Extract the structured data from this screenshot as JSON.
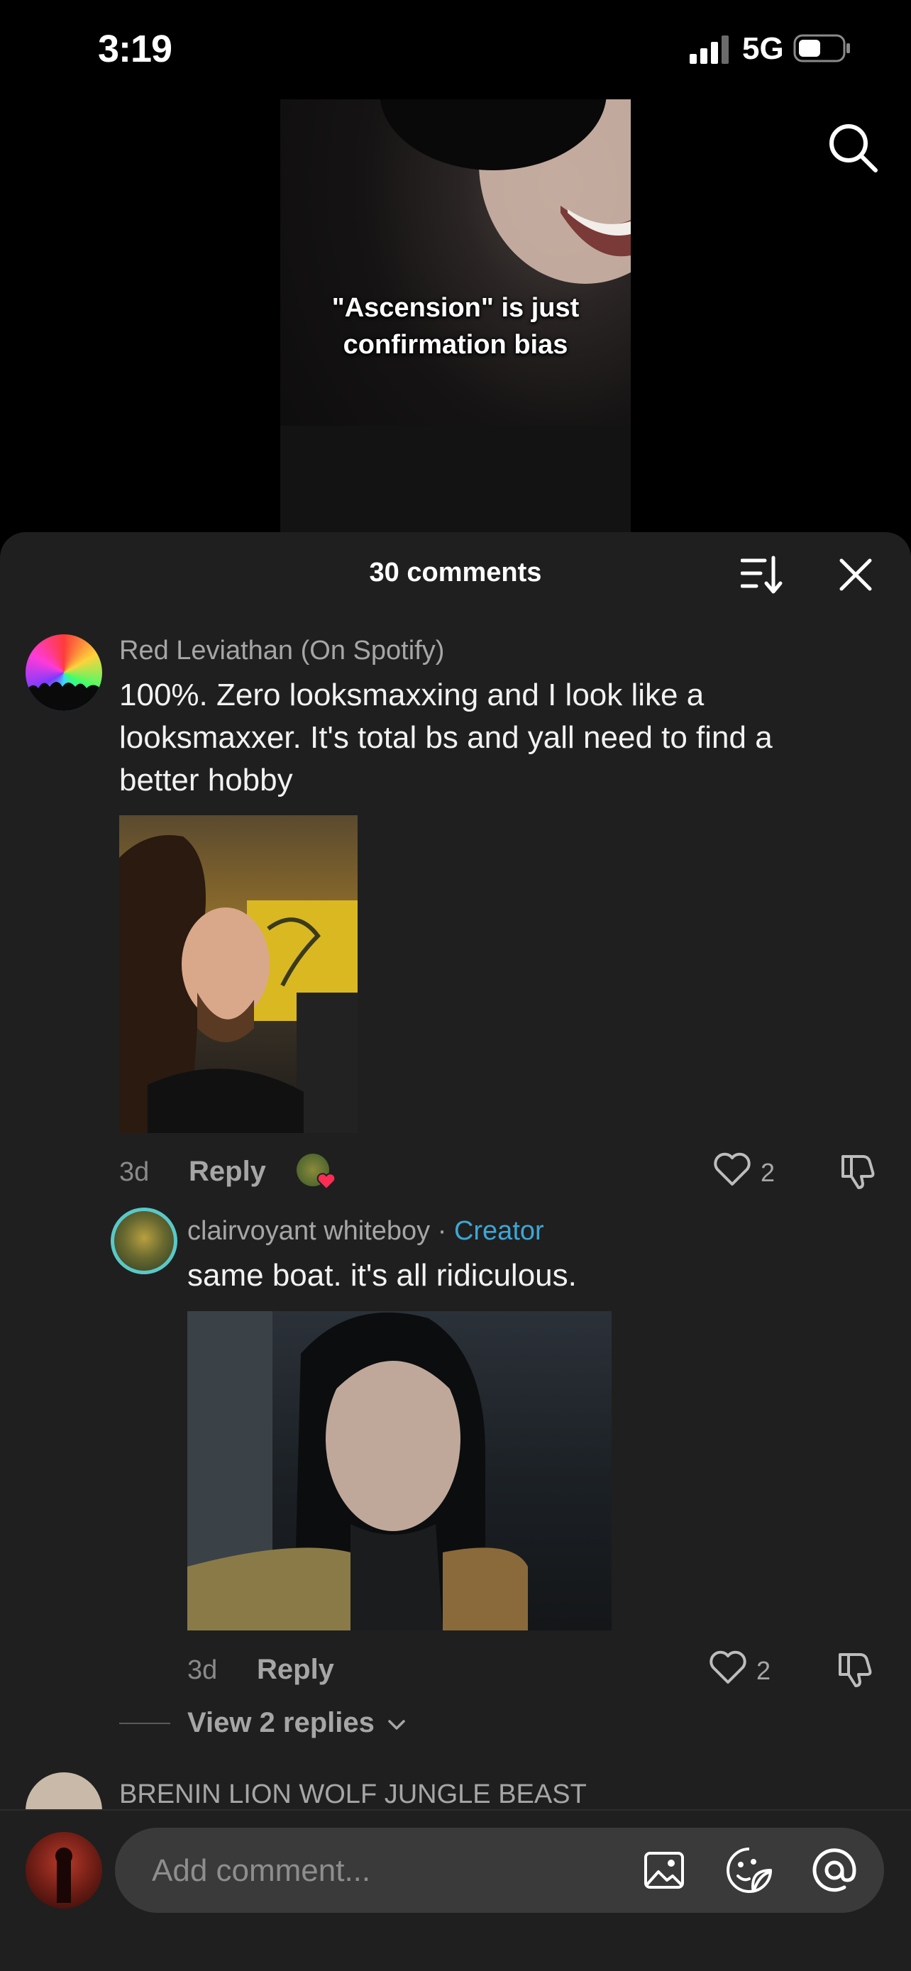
{
  "status_bar": {
    "time": "3:19",
    "network": "5G"
  },
  "video": {
    "caption_line1": "\"Ascension\" is just",
    "caption_line2": "confirmation bias"
  },
  "comments_panel": {
    "title": "30 comments",
    "comments": [
      {
        "username": "Red Leviathan (On Spotify)",
        "text_lines": [
          "100%. Zero looksmaxxing and I look like a",
          "looksmaxxer. It's total bs and yall need to find a",
          "better hobby"
        ],
        "age": "3d",
        "reply_label": "Reply",
        "likes": "2"
      }
    ],
    "reply": {
      "username": "clairvoyant whiteboy",
      "separator": " · ",
      "badge": "Creator",
      "text": "same boat. it's all ridiculous.",
      "age": "3d",
      "reply_label": "Reply",
      "likes": "2"
    },
    "view_replies": "View 2 replies",
    "next_comment_username": "BRENIN LION WOLF JUNGLE BEAST"
  },
  "input": {
    "placeholder": "Add comment..."
  },
  "colors": {
    "sheet_bg": "#1f1f1f",
    "creator": "#3ea6d6",
    "heart_badge": "#fe2c55"
  }
}
